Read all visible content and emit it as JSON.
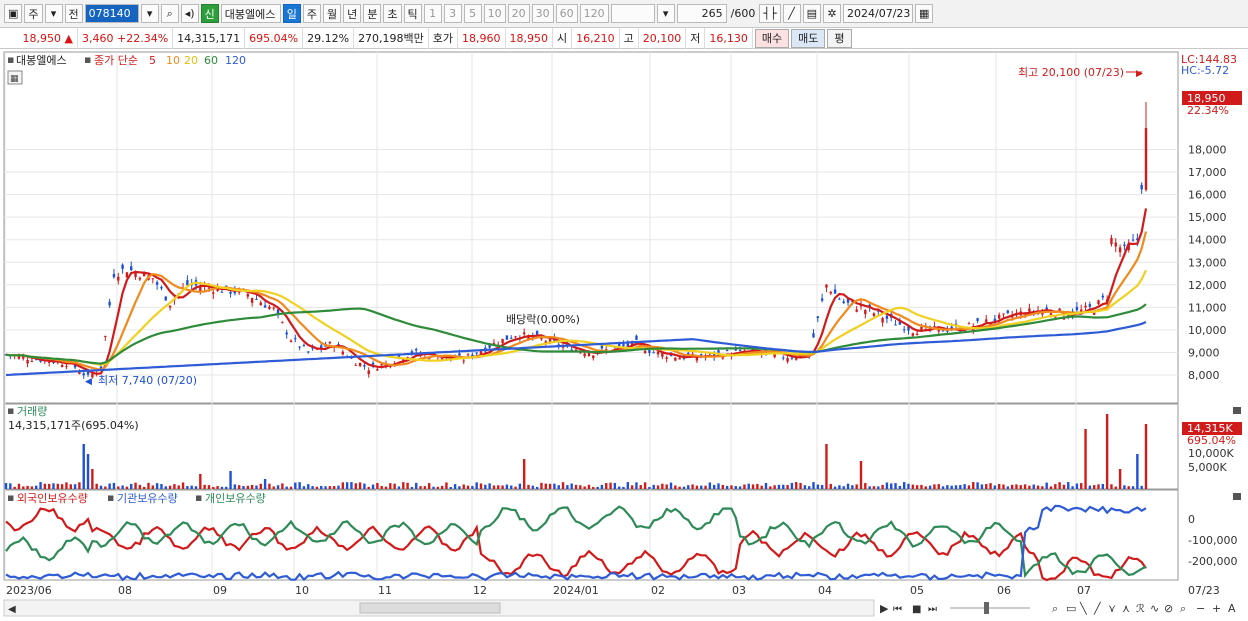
{
  "toolbar": {
    "market": "주",
    "prefix": "전",
    "code": "078140",
    "name": "대봉엘에스",
    "periods": [
      "일",
      "주",
      "월",
      "년",
      "분",
      "초",
      "틱"
    ],
    "active_period": "일",
    "tick_steps": [
      "1",
      "3",
      "5",
      "10",
      "20",
      "30",
      "60",
      "120"
    ],
    "count": "265",
    "count_total": "/600",
    "date": "2024/07/23",
    "new_badge": "신"
  },
  "quote": {
    "price": "18,950",
    "change": "3,460",
    "change_pct": "+22.34%",
    "volume": "14,315,171",
    "volume_ratio": "695.04%",
    "turnover": "29.12%",
    "amount": "270,198백만",
    "bid_label": "호가",
    "bid1": "18,960",
    "bid2": "18,950",
    "open_label": "시",
    "open": "16,210",
    "high_label": "고",
    "high": "20,100",
    "low_label": "저",
    "low": "16,130",
    "buy_label": "매수",
    "sell_label": "매도",
    "eval_label": "평"
  },
  "price_pane": {
    "legend_name": "대봉엘에스",
    "legend_ma": "종가 단순",
    "ma_periods": [
      "5",
      "10",
      "20",
      "60",
      "120"
    ],
    "ma_colors": [
      "#d11b1b",
      "#f08a1d",
      "#f0d020",
      "#2e8b3a",
      "#2e5bd6"
    ],
    "lc_label": "LC:144.83",
    "hc_label": "HC:-5.72",
    "high_note": "최고 20,100 (07/23)",
    "low_note": "최저 7,740 (07/20)",
    "dividend_note": "배당락(0.00%)",
    "last_price_tag": "18,950",
    "last_pct_tag": "22.34%",
    "y_ticks": [
      "18,000",
      "17,000",
      "16,000",
      "15,000",
      "14,000",
      "13,000",
      "12,000",
      "11,000",
      "10,000",
      "9,000",
      "8,000"
    ]
  },
  "volume_pane": {
    "title": "거래량",
    "value": "14,315,171주(695.04%)",
    "tag_value": "14,315K",
    "tag_pct": "695.04%",
    "y_ticks": [
      "10,000K",
      "5,000K"
    ]
  },
  "holding_pane": {
    "legend": [
      "외국인보유수량",
      "기관보유수량",
      "개인보유수량"
    ],
    "colors": [
      "#d11b1b",
      "#2e5bd6",
      "#2e8b58"
    ],
    "y_ticks": [
      "0",
      "-100,000",
      "-200,000"
    ]
  },
  "x_axis": {
    "labels": [
      "2023/06",
      "08",
      "09",
      "10",
      "11",
      "12",
      "2024/01",
      "02",
      "03",
      "04",
      "05",
      "06",
      "07"
    ],
    "right_label": "07/23"
  }
}
